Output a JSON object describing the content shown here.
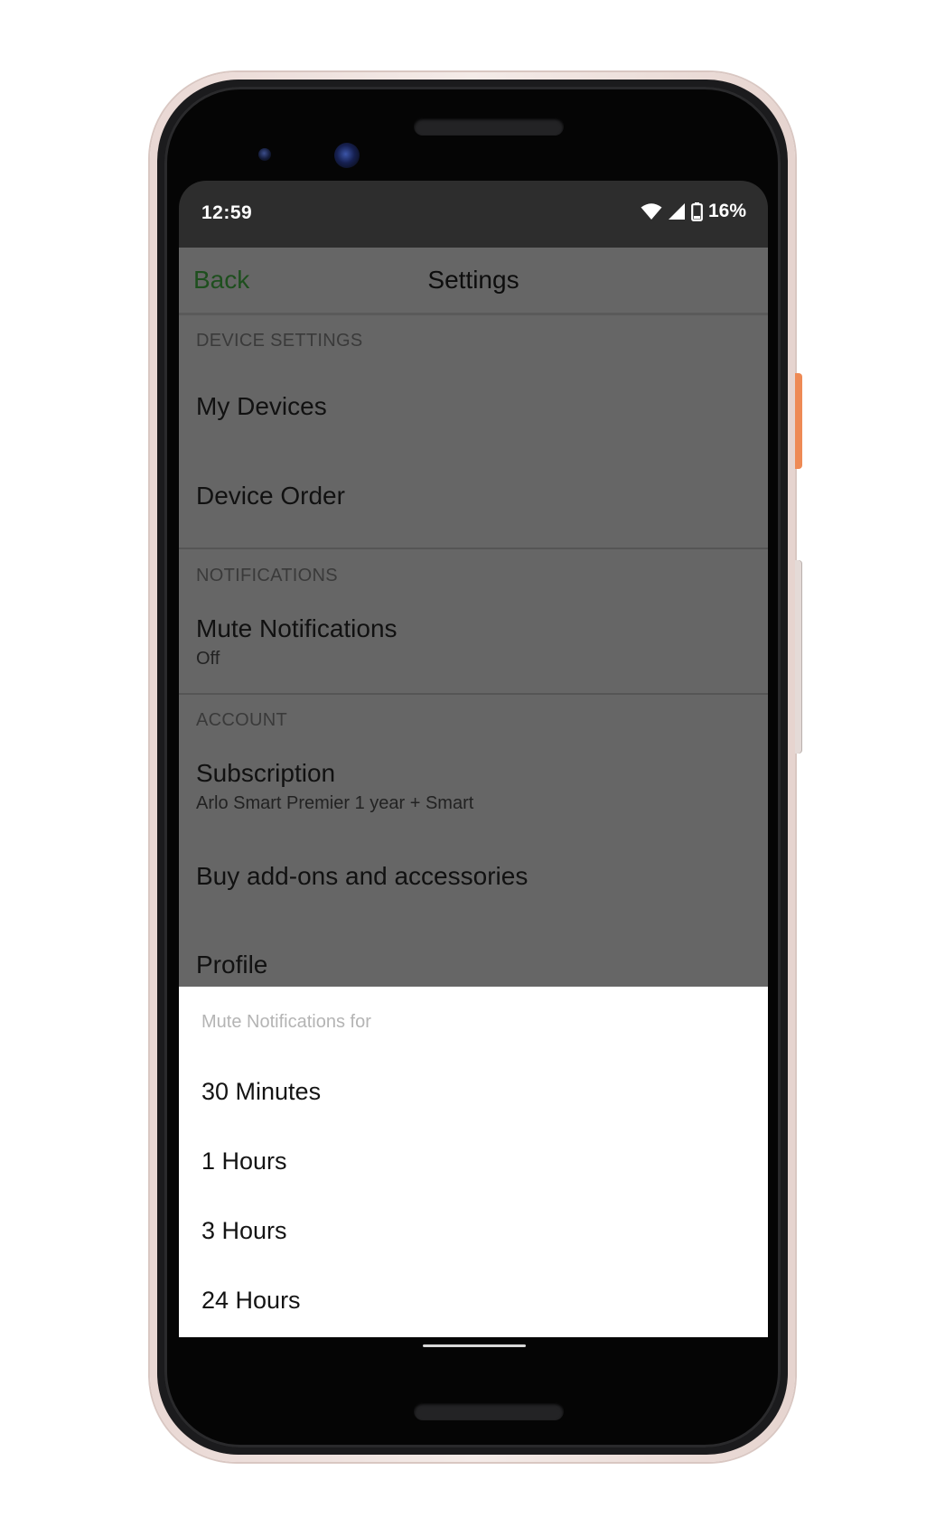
{
  "status_bar": {
    "time": "12:59",
    "battery": "16%",
    "icons": [
      "wifi-icon",
      "signal-icon",
      "battery-icon"
    ]
  },
  "header": {
    "back_label": "Back",
    "title": "Settings"
  },
  "sections": {
    "device_settings": {
      "header": "DEVICE SETTINGS",
      "my_devices": "My Devices",
      "device_order": "Device Order"
    },
    "notifications": {
      "header": "NOTIFICATIONS",
      "mute_title": "Mute Notifications",
      "mute_value": "Off"
    },
    "account": {
      "header": "ACCOUNT",
      "subscription_title": "Subscription",
      "subscription_value": "Arlo Smart Premier 1 year + Smart",
      "buy_addons": "Buy add-ons and accessories",
      "profile": "Profile"
    }
  },
  "sheet": {
    "title": "Mute Notifications for",
    "options": [
      "30 Minutes",
      "1 Hours",
      "3 Hours",
      "24 Hours"
    ]
  },
  "colors": {
    "accent_back": "#1e4f1e",
    "overlay": "#666666",
    "status_bar": "#2d2d2d",
    "phone_side_button": "#ee8a55"
  }
}
